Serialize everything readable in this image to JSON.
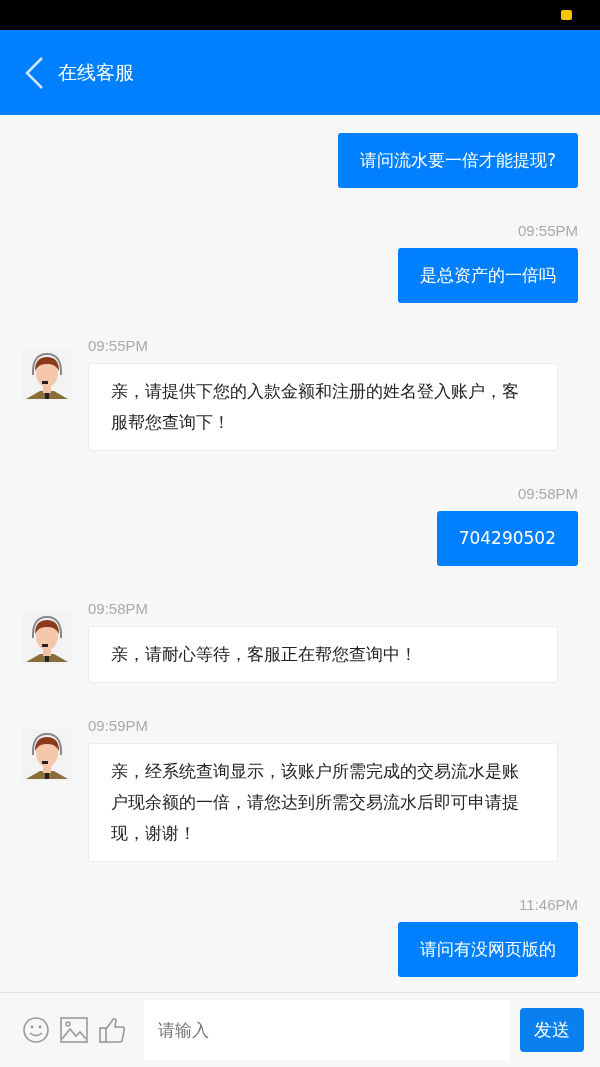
{
  "header": {
    "title": "在线客服"
  },
  "messages": [
    {
      "kind": "user",
      "text": "请问流水要一倍才能提现?"
    },
    {
      "kind": "user",
      "time": "09:55PM",
      "text": "是总资产的一倍吗"
    },
    {
      "kind": "agent",
      "time": "09:55PM",
      "text": "亲，请提供下您的入款金额和注册的姓名登入账户，客服帮您查询下！"
    },
    {
      "kind": "user",
      "time": "09:58PM",
      "text": "704290502"
    },
    {
      "kind": "agent",
      "time": "09:58PM",
      "text": "亲，请耐心等待，客服正在帮您查询中！"
    },
    {
      "kind": "agent",
      "time": "09:59PM",
      "text": "亲，经系统查询显示，该账户所需完成的交易流水是账户现余额的一倍，请您达到所需交易流水后即可申请提现，谢谢！"
    },
    {
      "kind": "user",
      "time": "11:46PM",
      "text": "请问有没网页版的"
    }
  ],
  "composer": {
    "placeholder": "请输入",
    "send": "发送"
  }
}
